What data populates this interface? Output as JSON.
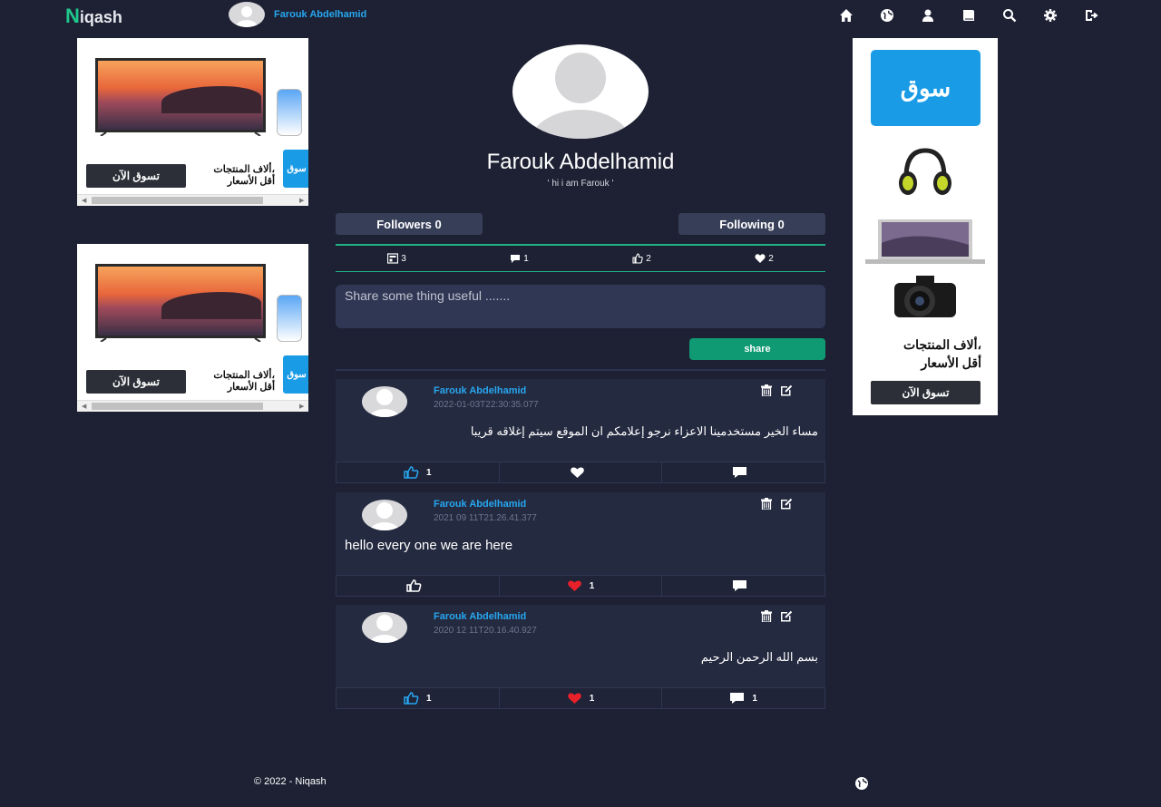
{
  "nav": {
    "brand_letter": "N",
    "brand_rest": "iqash",
    "user_name": "Farouk Abdelhamid",
    "icons": [
      "home-icon",
      "globe-icon",
      "user-icon",
      "book-icon",
      "search-icon",
      "gear-icon",
      "logout-icon"
    ]
  },
  "ads": {
    "left_text_line1": "ألاف المنتجات،",
    "left_text_line2": "أقل الأسعار",
    "left_button": "تسوق الآن",
    "left_logo": "سوق",
    "right_logo": "سوق",
    "right_text_line1": "ألاف المنتجات،",
    "right_text_line2": "أقل الأسعار",
    "right_button": "تسوق الآن"
  },
  "profile": {
    "name": "Farouk Abdelhamid",
    "bio": "' hi i am Farouk '",
    "followers_label": "Followers 0",
    "following_label": "Following 0"
  },
  "stats": {
    "posts": "3",
    "comments": "1",
    "likes": "2",
    "loves": "2"
  },
  "composer": {
    "placeholder": "Share some thing useful .......",
    "share_label": "share"
  },
  "posts": [
    {
      "author": "Farouk Abdelhamid",
      "date": "2022-01-03T22:30:35.077",
      "body": "مساء الخير مستخدمينا الاعزاء نرجو إعلامكم ان الموقع سيتم إغلاقه قريبا",
      "rtl": true,
      "likes": "1",
      "loves": "",
      "comments": "",
      "liked": true,
      "loved": false
    },
    {
      "author": "Farouk Abdelhamid",
      "date": "2021 09 11T21.26.41.377",
      "body": "hello every one we are here",
      "rtl": false,
      "likes": "",
      "loves": "1",
      "comments": "",
      "liked": false,
      "loved": true
    },
    {
      "author": "Farouk Abdelhamid",
      "date": "2020 12 11T20.16.40.927",
      "body": "بسم الله الرحمن الرحيم",
      "rtl": true,
      "likes": "1",
      "loves": "1",
      "comments": "1",
      "liked": true,
      "loved": true
    }
  ],
  "footer": {
    "copyright": "© 2022 - Niqash"
  },
  "colors": {
    "background": "#1d2133",
    "accent_green": "#1fb385",
    "link_blue": "#27a7f0",
    "like_blue": "#27a7f0",
    "love_red": "#e8202a"
  }
}
